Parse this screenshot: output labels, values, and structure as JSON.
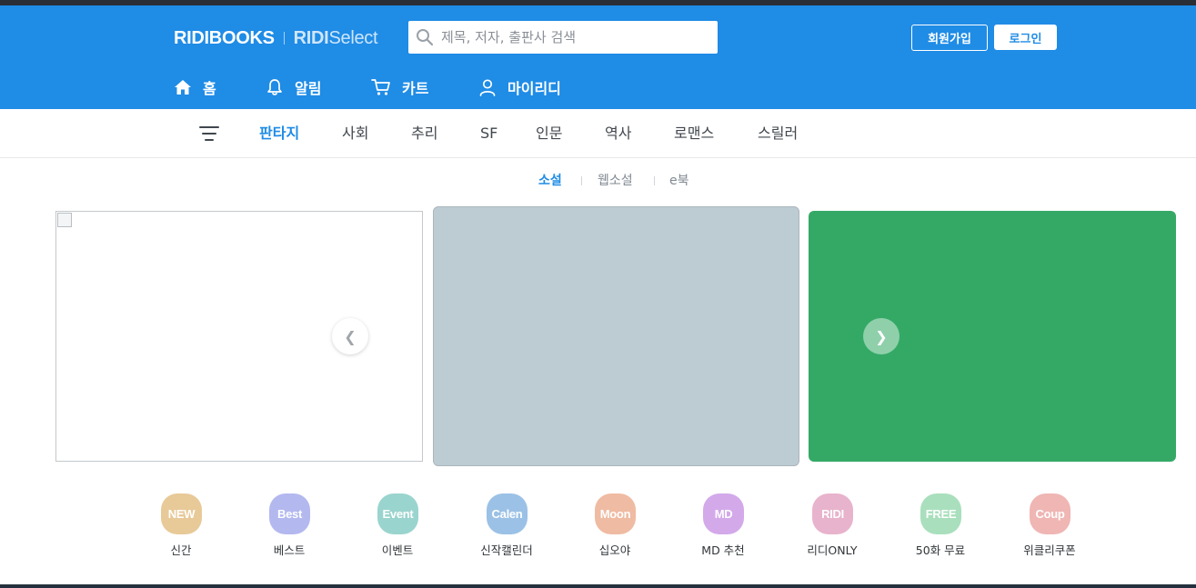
{
  "header": {
    "logo_main": "RIDIBOOKS",
    "logo_select_bold": "RIDI",
    "logo_select_rest": "Select",
    "search_placeholder": "제목, 저자, 출판사 검색",
    "signup_label": "회원가입",
    "login_label": "로그인",
    "accent_color": "#1f8ce6"
  },
  "gnb": {
    "items": [
      {
        "label": "홈",
        "icon": "home-icon"
      },
      {
        "label": "알림",
        "icon": "bell-icon"
      },
      {
        "label": "카트",
        "icon": "cart-icon"
      },
      {
        "label": "마이리디",
        "icon": "user-icon"
      }
    ]
  },
  "genres": {
    "menu_icon": "menu-icon",
    "items": [
      "판타지",
      "사회",
      "추리",
      "SF",
      "인문",
      "역사",
      "로맨스",
      "스릴러"
    ],
    "active": "판타지"
  },
  "subtabs": {
    "items": [
      "소설",
      "웹소설",
      "e북"
    ],
    "active": "소설"
  },
  "carousel": {
    "prev_symbol": "❮",
    "next_symbol": "❯",
    "banner_colors": [
      "#ffffff",
      "#bdcbd2",
      "#34a966"
    ]
  },
  "quick_menu": [
    {
      "icon_text": "NEW",
      "label": "신간",
      "color": "#e8c998"
    },
    {
      "icon_text": "Best",
      "label": "베스트",
      "color": "#b3b8ef"
    },
    {
      "icon_text": "Event",
      "label": "이벤트",
      "color": "#9ad4ce"
    },
    {
      "icon_text": "Calen",
      "label": "신작캘린더",
      "color": "#9bc1e6"
    },
    {
      "icon_text": "Moon",
      "label": "십오야",
      "color": "#efbba2"
    },
    {
      "icon_text": "MD",
      "label": "MD 추천",
      "color": "#d3a9ea"
    },
    {
      "icon_text": "RIDI",
      "label": "리디ONLY",
      "color": "#e8b3cc"
    },
    {
      "icon_text": "FREE",
      "label": "50화 무료",
      "color": "#a9dfbd"
    },
    {
      "icon_text": "Coup",
      "label": "위클리쿠폰",
      "color": "#efb6b4"
    }
  ]
}
